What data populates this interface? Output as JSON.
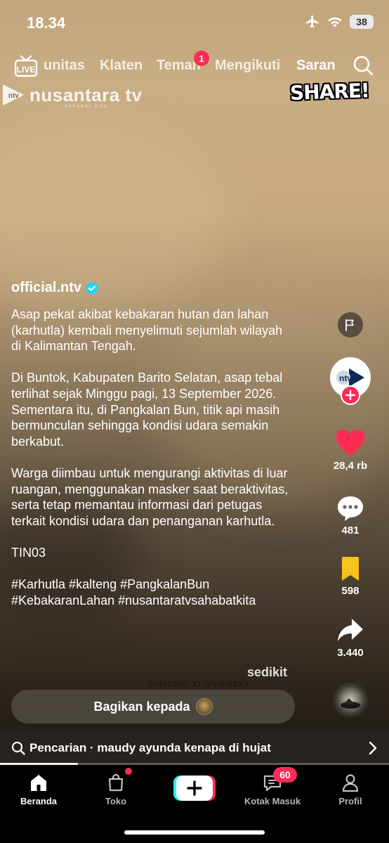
{
  "status_bar": {
    "time": "18.34",
    "battery": "38"
  },
  "top_nav": {
    "tabs": [
      {
        "label": "unitas"
      },
      {
        "label": "Klaten"
      },
      {
        "label": "Teman"
      },
      {
        "label": "Mengikuti"
      },
      {
        "label": "Saran"
      }
    ],
    "active_tab": "Saran",
    "friends_badge": "1",
    "live_label": "LIVE"
  },
  "video_overlay": {
    "channel_watermark": "nusantara tv",
    "channel_watermark_sub": "sahabat kita",
    "channel_watermark_badge": "ntv",
    "share_sticker": "SHARE!",
    "source_watermark": "SUMBER: X/ @VIER4X4"
  },
  "post": {
    "username": "official.ntv",
    "verified": true,
    "caption_paragraphs": [
      "Asap pekat akibat kebakaran hutan dan lahan (karhutla) kembali menyelimuti sejumlah wilayah di Kalimantan Tengah.",
      "Di Buntok, Kabupaten Barito Selatan, asap tebal terlihat sejak Minggu pagi, 13 September 2026. Sementara itu, di Pangkalan Bun, titik api masih bermunculan sehingga kondisi udara semakin berkabut.",
      "Warga diimbau untuk mengurangi aktivitas di luar ruangan, menggunakan masker saat beraktivitas, serta tetap memantau informasi dari petugas terkait kondisi udara dan penanganan karhutla.",
      "TIN03",
      "#Karhutla #kalteng #PangkalanBun #KebakaranLahan #nusantaratvsahabatkita"
    ],
    "less_label": "sedikit",
    "share_bar_label": "Bagikan kepada"
  },
  "action_rail": {
    "creator_avatar_text": "ntv",
    "likes": "28,4 rb",
    "comments": "481",
    "saves": "598",
    "shares": "3.440"
  },
  "search_strip": {
    "text": "Pencarian · maudy ayunda kenapa di hujat"
  },
  "progress": {
    "fraction": 0.2
  },
  "bottom_nav": {
    "home": "Beranda",
    "shop": "Toko",
    "inbox": "Kotak Masuk",
    "inbox_badge": "60",
    "profile": "Profil"
  },
  "colors": {
    "accent": "#fe2c55",
    "save": "#f7c31d",
    "verified": "#20d5ec"
  }
}
